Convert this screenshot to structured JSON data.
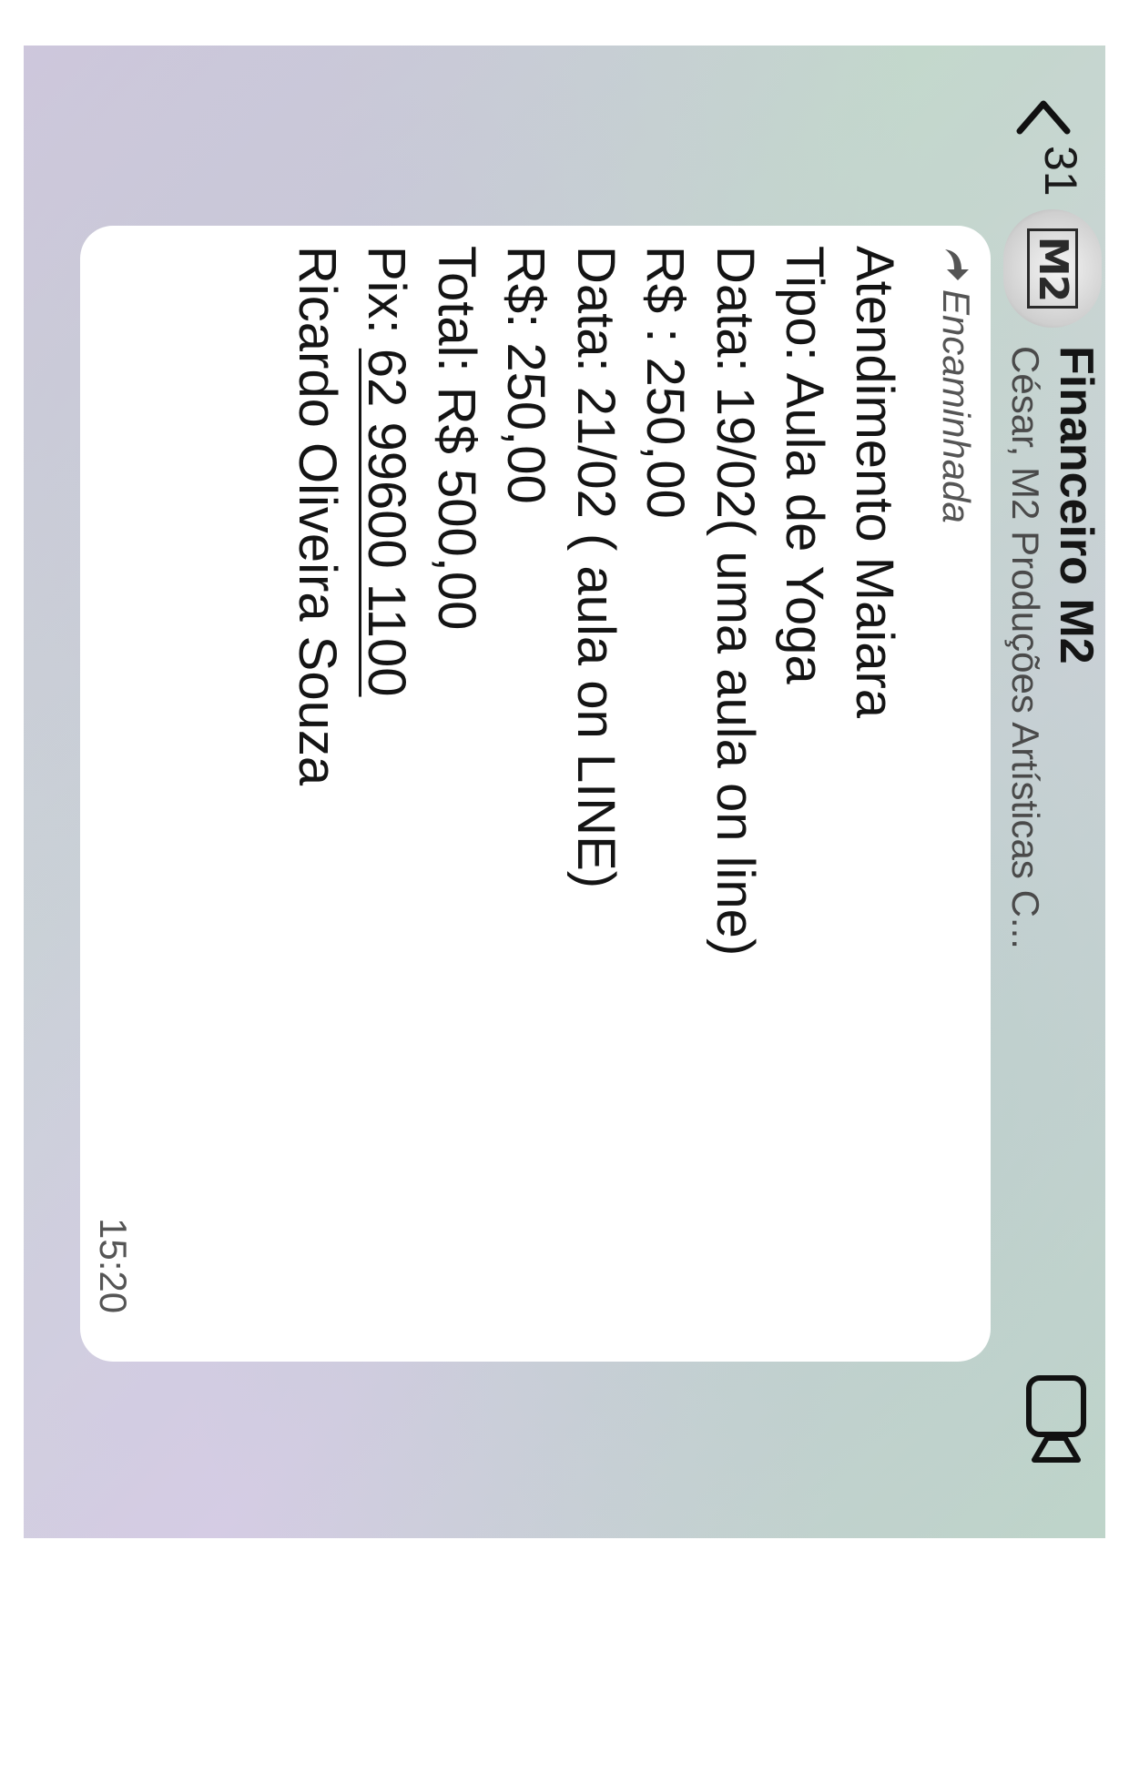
{
  "header": {
    "back_label": "<",
    "unread_count": "31",
    "avatar_text": "M2",
    "title": "Financeiro M2",
    "subtitle": "César, M2 Produções Artísticas C..."
  },
  "message": {
    "forwarded_label": "Encaminhada",
    "lines": [
      "Atendimento Maiara",
      "Tipo: Aula de Yoga",
      "Data: 19/02( uma aula on line)",
      "R$ : 250,00",
      "Data: 21/02 ( aula on LINE)",
      "R$: 250,00",
      "Total: R$ 500,00"
    ],
    "pix_label": "Pix: ",
    "pix_number": "62 99600 1100",
    "signature": "Ricardo Oliveira Souza",
    "time": "15:20"
  },
  "icons": {
    "back": "chevron-left-icon",
    "forward": "forward-arrow-icon",
    "video": "video-camera-icon"
  }
}
